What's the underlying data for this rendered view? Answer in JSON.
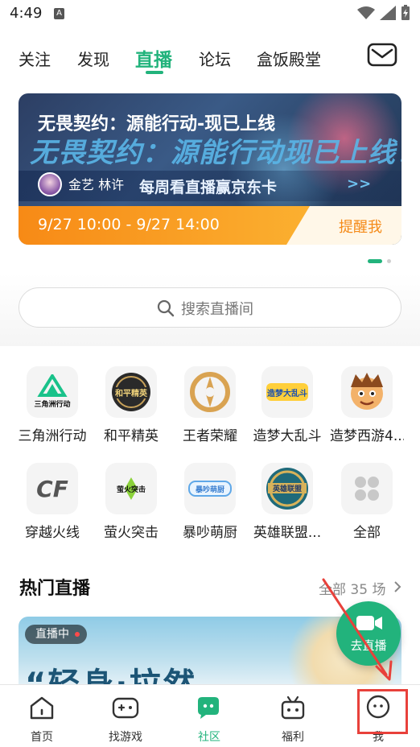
{
  "status_bar": {
    "time": "4:49",
    "notification_icon": "A"
  },
  "tabs": [
    {
      "label": "关注",
      "active": false
    },
    {
      "label": "发现",
      "active": false
    },
    {
      "label": "直播",
      "active": true
    },
    {
      "label": "论坛",
      "active": false
    },
    {
      "label": "盒饭殿堂",
      "active": false
    }
  ],
  "mail_icon": "mail-icon",
  "banner": {
    "title": "无畏契约：源能行动-现已上线",
    "art_text": "无畏契约：源能行动现已上线！",
    "art_subtext": "每周看直播赢京东卡",
    "streamer": "金艺 林许",
    "time_range": "9/27 10:00 - 9/27 14:00",
    "remind": "提醒我",
    "slides_total": 2,
    "current_slide": 1
  },
  "search": {
    "placeholder": "搜索直播间"
  },
  "games": [
    {
      "label": "三角洲行动",
      "icon": "delta-force-icon",
      "mark": "三角洲行动"
    },
    {
      "label": "和平精英",
      "icon": "peace-elite-icon",
      "mark": "和平精英"
    },
    {
      "label": "王者荣耀",
      "icon": "honor-of-kings-icon",
      "mark": ""
    },
    {
      "label": "造梦大乱斗",
      "icon": "zaomeng-brawl-icon",
      "mark": "造梦大乱斗"
    },
    {
      "label": "造梦西游4...",
      "icon": "zaomeng-journey-icon",
      "mark": ""
    },
    {
      "label": "穿越火线",
      "icon": "crossfire-icon",
      "mark": "CF"
    },
    {
      "label": "萤火突击",
      "icon": "firefly-assault-icon",
      "mark": "萤火突击"
    },
    {
      "label": "暴吵萌厨",
      "icon": "cute-chef-icon",
      "mark": "暴吵萌厨"
    },
    {
      "label": "英雄联盟...",
      "icon": "league-icon",
      "mark": "英雄联盟"
    },
    {
      "label": "全部",
      "icon": "all-games-icon",
      "mark": ""
    }
  ],
  "hot_live": {
    "title": "热门直播",
    "all_label": "全部 35 场",
    "card": {
      "badge": "直播中",
      "art_text": "“轻身·拉然"
    }
  },
  "float_button": {
    "label": "去直播"
  },
  "bottom_nav": [
    {
      "label": "首页",
      "icon": "home-icon",
      "active": false
    },
    {
      "label": "找游戏",
      "icon": "gamepad-icon",
      "active": false
    },
    {
      "label": "社区",
      "icon": "community-icon",
      "active": true
    },
    {
      "label": "福利",
      "icon": "gift-icon",
      "active": false
    },
    {
      "label": "我",
      "icon": "profile-icon",
      "active": false
    }
  ],
  "colors": {
    "accent": "#22b37c",
    "orange": "#f78a16",
    "annotation": "#e8413b"
  }
}
